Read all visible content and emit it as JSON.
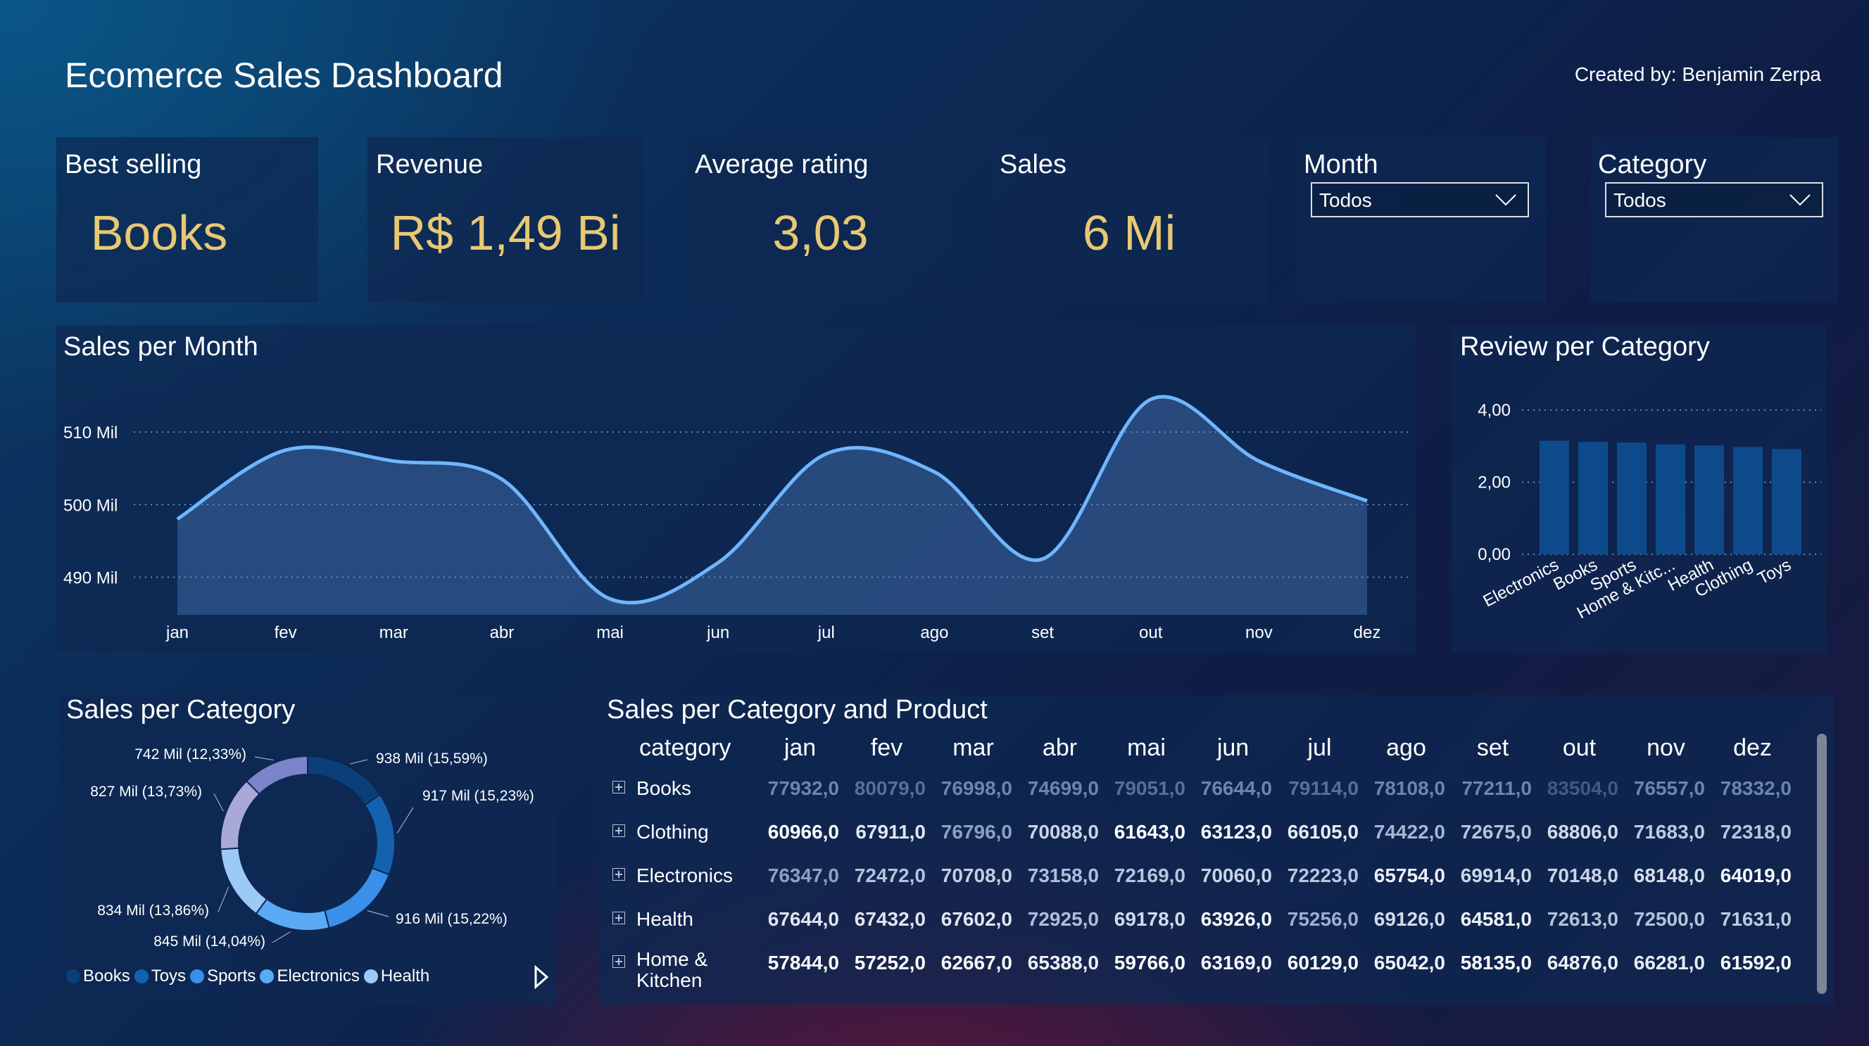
{
  "header": {
    "title": "Ecomerce Sales Dashboard",
    "creator": "Created by: Benjamin Zerpa"
  },
  "kpis": [
    {
      "label": "Best selling",
      "value": "Books"
    },
    {
      "label": "Revenue",
      "value": "R$ 1,49 Bi"
    },
    {
      "label": "Average rating",
      "value": "3,03"
    },
    {
      "label": "Sales",
      "value": "6 Mi"
    }
  ],
  "slicers": {
    "month": {
      "label": "Month",
      "value": "Todos"
    },
    "category": {
      "label": "Category",
      "value": "Todos"
    }
  },
  "colors": {
    "kpi_value": "#e8c873",
    "line": "#6fb6ff",
    "bar": "#0d4a8c",
    "donut": [
      "#0a3f7a",
      "#1461b0",
      "#3a8fe8",
      "#5aaaf6",
      "#9cc9f5",
      "#a9a9d8",
      "#7b84c8"
    ]
  },
  "sales_per_month": {
    "title": "Sales per Month",
    "chart_data": {
      "type": "area",
      "x": [
        "jan",
        "fev",
        "mar",
        "abr",
        "mai",
        "jun",
        "jul",
        "ago",
        "set",
        "out",
        "nov",
        "dez"
      ],
      "values": [
        498,
        507.5,
        506,
        503.5,
        487,
        492,
        507,
        504.5,
        492.5,
        514.5,
        506,
        500.5
      ],
      "yticks": [
        "510 Mil",
        "500 Mil",
        "490 Mil"
      ],
      "ytick_values": [
        510,
        500,
        490
      ],
      "ylim": [
        485,
        517
      ],
      "grid": true
    }
  },
  "review_per_category": {
    "title": "Review per Category",
    "chart_data": {
      "type": "bar",
      "categories": [
        "Electronics",
        "Books",
        "Sports",
        "Home & Kitc...",
        "Health",
        "Clothing",
        "Toys"
      ],
      "values": [
        3.15,
        3.12,
        3.1,
        3.05,
        3.02,
        2.98,
        2.92
      ],
      "yticks": [
        "4,00",
        "2,00",
        "0,00"
      ],
      "ytick_values": [
        4,
        2,
        0
      ],
      "ylim": [
        0,
        4.8
      ],
      "grid": true
    }
  },
  "sales_per_category": {
    "title": "Sales per Category",
    "chart_data": {
      "type": "pie",
      "labels": [
        "938 Mil (15,59%)",
        "917 Mil (15,23%)",
        "916 Mil (15,22%)",
        "845 Mil (14,04%)",
        "834 Mil (13,86%)",
        "827 Mil (13,73%)",
        "742 Mil (12,33%)"
      ],
      "values": [
        938,
        917,
        916,
        845,
        834,
        827,
        742
      ]
    },
    "legend": [
      "Books",
      "Toys",
      "Sports",
      "Electronics",
      "Health"
    ]
  },
  "matrix": {
    "title": "Sales per Category and Product",
    "columns": [
      "category",
      "jan",
      "fev",
      "mar",
      "abr",
      "mai",
      "jun",
      "jul",
      "ago",
      "set",
      "out",
      "nov",
      "dez"
    ],
    "rows": [
      {
        "category": "Books",
        "values": [
          "77932,0",
          "80079,0",
          "76998,0",
          "74699,0",
          "79051,0",
          "76644,0",
          "79114,0",
          "78108,0",
          "77211,0",
          "83504,0",
          "76557,0",
          "78332,0"
        ],
        "shades": [
          "#6b86ad",
          "#55709a",
          "#6b86ad",
          "#6b86ad",
          "#55709a",
          "#6b86ad",
          "#55709a",
          "#6b86ad",
          "#6b86ad",
          "#3f5a85",
          "#6b86ad",
          "#6b86ad"
        ]
      },
      {
        "category": "Clothing",
        "values": [
          "60966,0",
          "67911,0",
          "76796,0",
          "70088,0",
          "61643,0",
          "63123,0",
          "66105,0",
          "74422,0",
          "72675,0",
          "68806,0",
          "71683,0",
          "72318,0"
        ],
        "shades": [
          "#ffffff",
          "#dfe6f1",
          "#8aa2c5",
          "#c9d4e6",
          "#ffffff",
          "#f4f7fb",
          "#e6ecf5",
          "#a3b6d3",
          "#b3c3dc",
          "#d2dcea",
          "#bccbe1",
          "#b7c6de"
        ]
      },
      {
        "category": "Electronics",
        "values": [
          "76347,0",
          "72472,0",
          "70708,0",
          "73158,0",
          "72169,0",
          "70060,0",
          "72223,0",
          "65754,0",
          "69914,0",
          "70148,0",
          "68148,0",
          "64019,0"
        ],
        "shades": [
          "#8aa2c5",
          "#b3c3dc",
          "#c3cfe3",
          "#adbfd9",
          "#b7c6de",
          "#c9d4e6",
          "#b7c6de",
          "#e9eef6",
          "#cdd8e8",
          "#c9d4e6",
          "#d6dfec",
          "#f4f7fb"
        ]
      },
      {
        "category": "Health",
        "values": [
          "67644,0",
          "67432,0",
          "67602,0",
          "72925,0",
          "69178,0",
          "63926,0",
          "75256,0",
          "69126,0",
          "64581,0",
          "72613,0",
          "72500,0",
          "71631,0"
        ],
        "shades": [
          "#dfe6f1",
          "#dfe6f1",
          "#dfe6f1",
          "#adbfd9",
          "#d2dcea",
          "#f4f7fb",
          "#9bb0cf",
          "#d2dcea",
          "#f0f4f9",
          "#b3c3dc",
          "#b3c3dc",
          "#bccbe1"
        ]
      },
      {
        "category": "Home & Kitchen",
        "values": [
          "57844,0",
          "57252,0",
          "62667,0",
          "65388,0",
          "59766,0",
          "63169,0",
          "60129,0",
          "65042,0",
          "58135,0",
          "64876,0",
          "66281,0",
          "61592,0"
        ],
        "shades": [
          "#ffffff",
          "#ffffff",
          "#f7f9fc",
          "#ecf0f7",
          "#ffffff",
          "#f4f7fb",
          "#ffffff",
          "#eef2f8",
          "#ffffff",
          "#eef2f8",
          "#e6ecf5",
          "#fafbfd"
        ]
      }
    ]
  }
}
